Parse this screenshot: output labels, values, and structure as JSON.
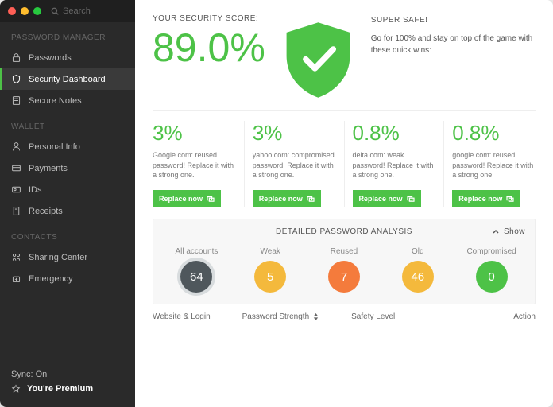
{
  "search_placeholder": "Search",
  "sidebar": {
    "sections": [
      {
        "header": "PASSWORD MANAGER",
        "items": [
          {
            "label": "Passwords",
            "icon": "lock-icon"
          },
          {
            "label": "Security Dashboard",
            "icon": "shield-icon"
          },
          {
            "label": "Secure Notes",
            "icon": "note-icon"
          }
        ]
      },
      {
        "header": "WALLET",
        "items": [
          {
            "label": "Personal Info",
            "icon": "person-icon"
          },
          {
            "label": "Payments",
            "icon": "card-icon"
          },
          {
            "label": "IDs",
            "icon": "id-icon"
          },
          {
            "label": "Receipts",
            "icon": "receipt-icon"
          }
        ]
      },
      {
        "header": "CONTACTS",
        "items": [
          {
            "label": "Sharing Center",
            "icon": "share-icon"
          },
          {
            "label": "Emergency",
            "icon": "emergency-icon"
          }
        ]
      }
    ],
    "sync_label": "Sync: On",
    "premium_label": "You're Premium"
  },
  "score": {
    "label": "YOUR SECURITY SCORE:",
    "value": "89.0%"
  },
  "safe": {
    "title": "SUPER SAFE!",
    "tip": "Go for 100% and stay on top of the game with these quick wins:"
  },
  "cards": [
    {
      "pct": "3%",
      "desc": "Google.com: reused password! Replace it with a strong one.",
      "button": "Replace now"
    },
    {
      "pct": "3%",
      "desc": "yahoo.com: compromised password! Replace it with a strong one.",
      "button": "Replace now"
    },
    {
      "pct": "0.8%",
      "desc": "delta.com: weak password! Replace it with a strong one.",
      "button": "Replace now"
    },
    {
      "pct": "0.8%",
      "desc": "google.com: reused password! Replace it with a strong one.",
      "button": "Replace now"
    }
  ],
  "analysis": {
    "header": "DETAILED PASSWORD ANALYSIS",
    "toggle": "Show",
    "circles": [
      {
        "label": "All accounts",
        "value": "64",
        "color": "#4f575c",
        "class": "all"
      },
      {
        "label": "Weak",
        "value": "5",
        "color": "#f4b93c"
      },
      {
        "label": "Reused",
        "value": "7",
        "color": "#f47b3c"
      },
      {
        "label": "Old",
        "value": "46",
        "color": "#f4b93c"
      },
      {
        "label": "Compromised",
        "value": "0",
        "color": "#4dc247"
      }
    ]
  },
  "table_headers": [
    "Website & Login",
    "Password Strength",
    "Safety Level",
    "Action"
  ]
}
